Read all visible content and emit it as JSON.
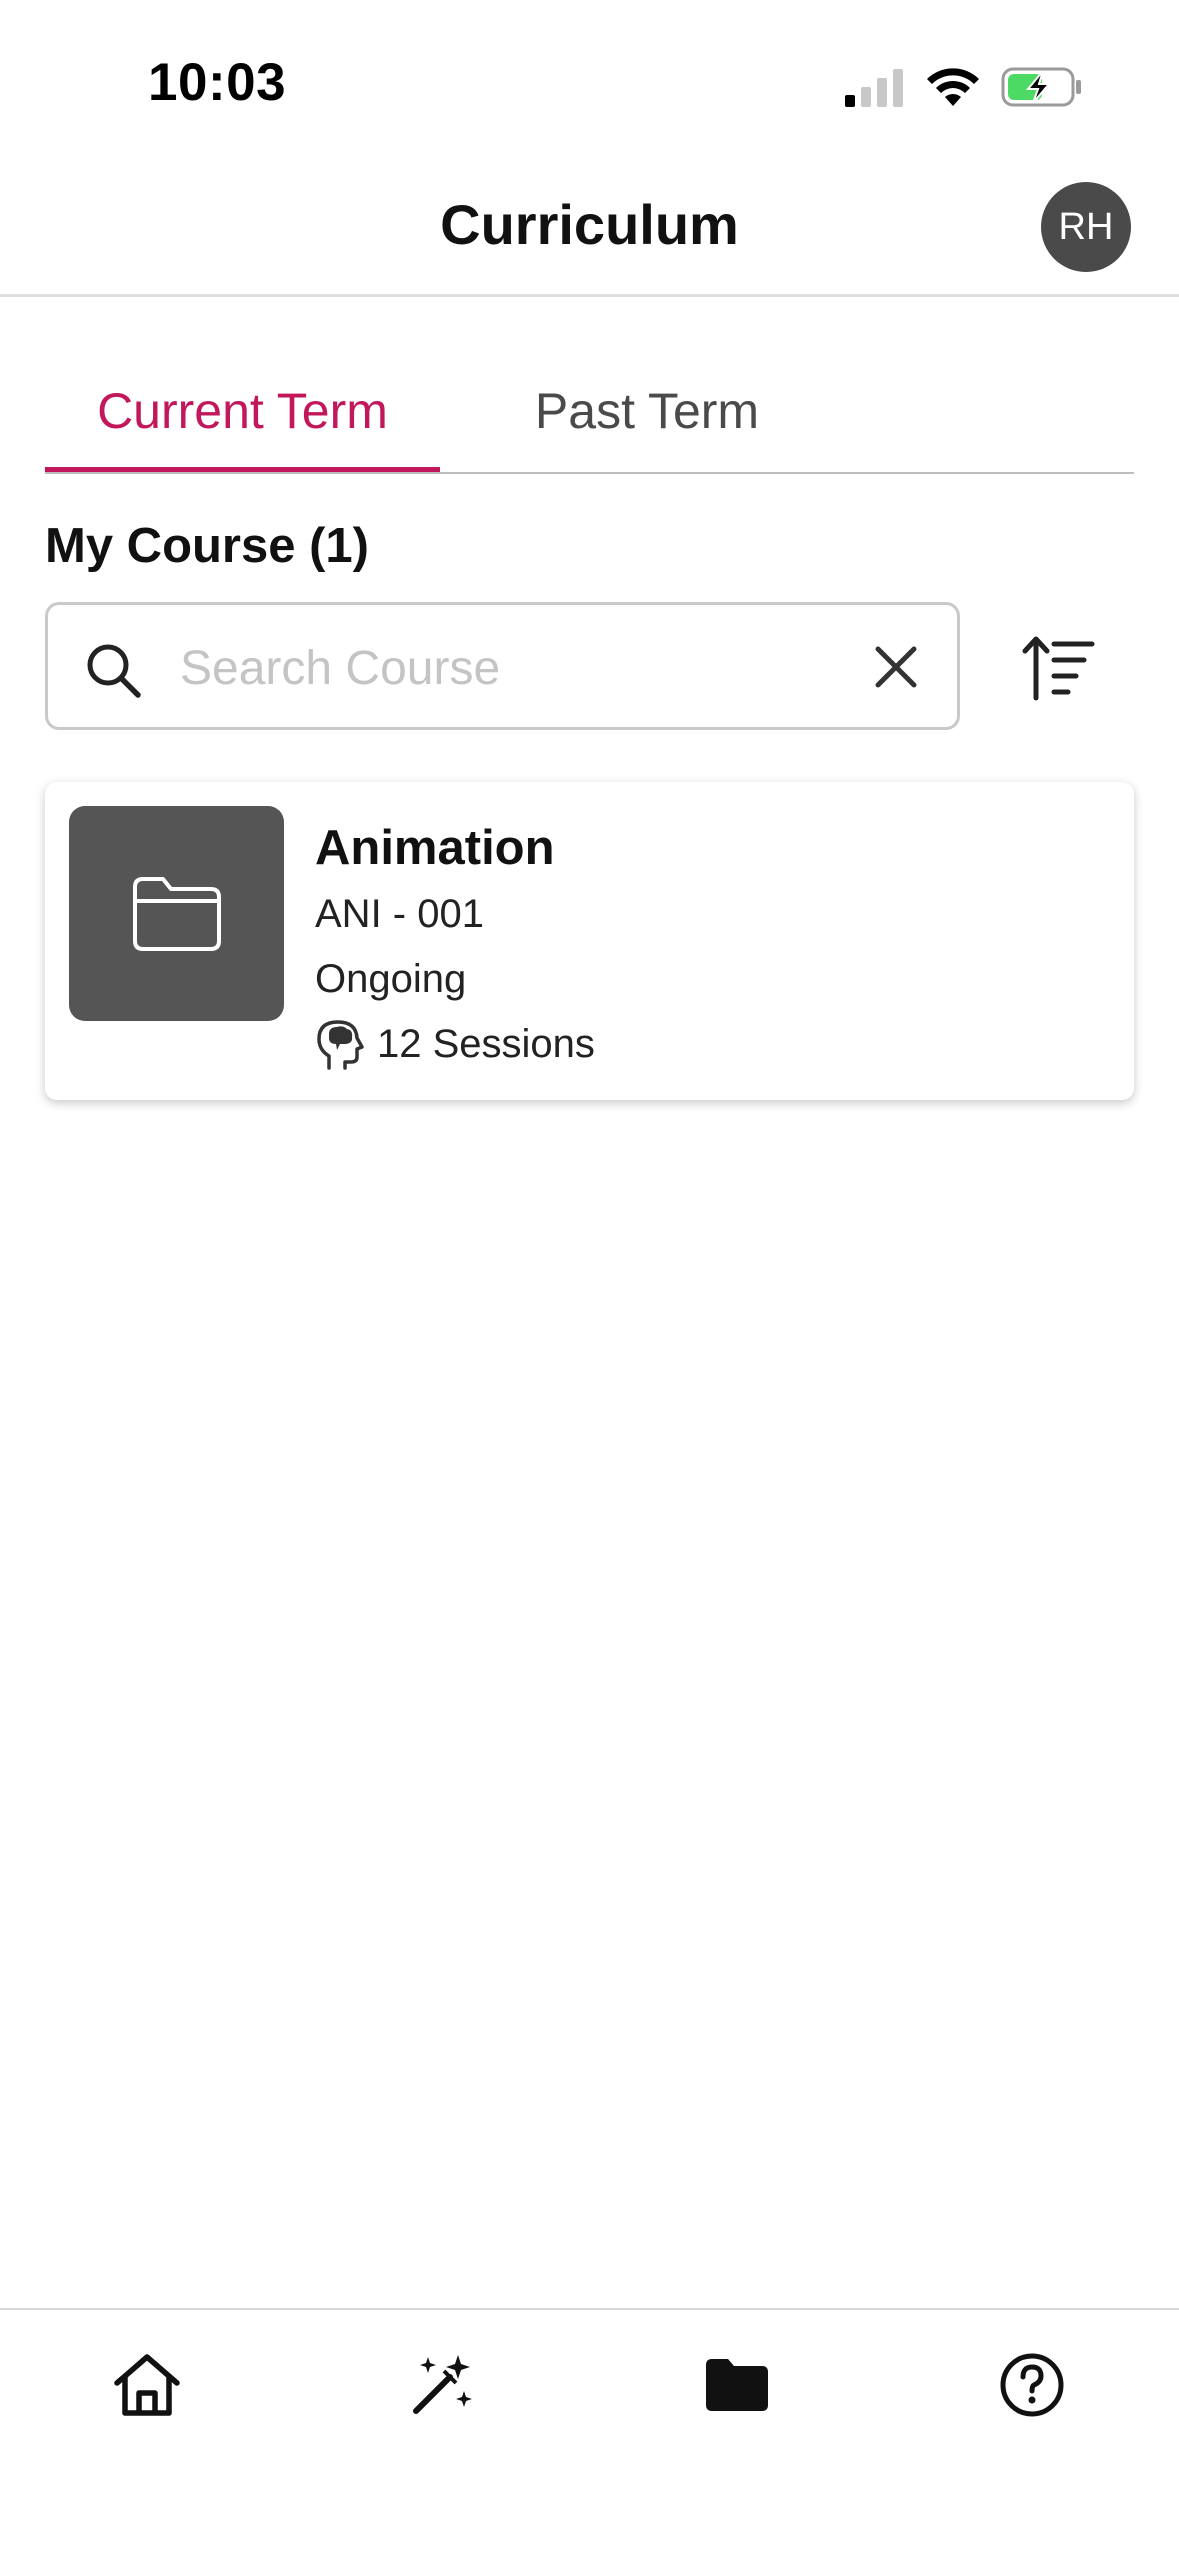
{
  "status_bar": {
    "time": "10:03"
  },
  "header": {
    "title": "Curriculum",
    "avatar_initials": "RH"
  },
  "tabs": [
    {
      "label": "Current Term",
      "active": true
    },
    {
      "label": "Past Term",
      "active": false
    }
  ],
  "section": {
    "title": "My Course (1)"
  },
  "search": {
    "placeholder": "Search Course",
    "value": ""
  },
  "courses": [
    {
      "name": "Animation",
      "code": "ANI - 001",
      "status": "Ongoing",
      "sessions": "12 Sessions"
    }
  ],
  "bottom_nav": {
    "items": [
      {
        "icon": "home-icon",
        "active": false
      },
      {
        "icon": "magic-wand-icon",
        "active": false
      },
      {
        "icon": "folder-icon",
        "active": true
      },
      {
        "icon": "help-icon",
        "active": false
      }
    ]
  },
  "colors": {
    "accent": "#c2185b",
    "thumb_bg": "#555555",
    "avatar_bg": "#4a4a4a"
  }
}
